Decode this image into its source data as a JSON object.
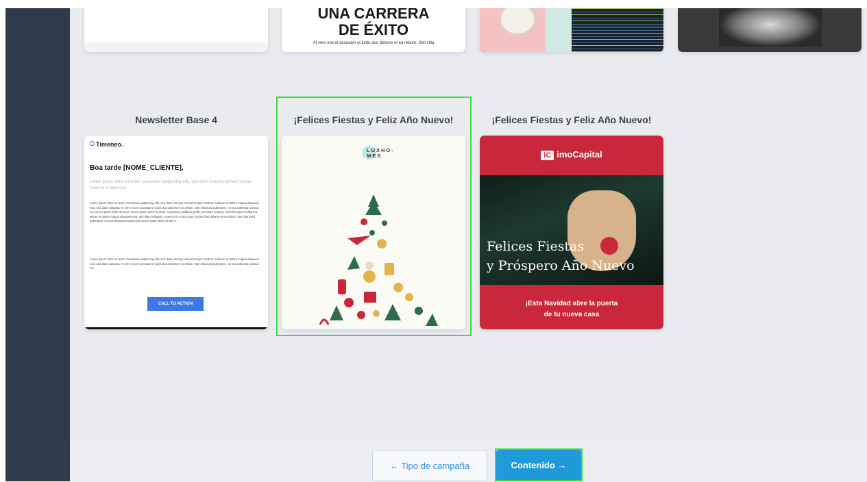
{
  "top_cards": {
    "card2_title_line1": "UNA CARRERA",
    "card2_title_line2": "DE ÉXITO",
    "card2_text": "At vero eos et accusam et justo duo dolores et ea rebum. Stet clita"
  },
  "templates": [
    {
      "title": "Newsletter Base 4",
      "brand": "Timeneo.",
      "greeting": "Boa tarde [NOME_CLIENTE],",
      "lead": "Lorem ipsum dolor sit amet, consetetur sadipscing elitr, sed diam nonumy eirmod tempor invidunt ut labore et.",
      "body1": "Lorem ipsum dolor sit amet, consetetur sadipscing elitr, sed diam nonumy eirmod tempor invidunt ut labore et dolore magna aliquyam erat, sed diam voluptua. At vero eos et accusam et justo duo dolores et ea rebum. Stet clita kasd gubergren, no sea takimata sanctus est Lorem ipsum dolor sit amet. Lorem ipsum dolor sit amet, consetetur sadipscing elitr, sed diam nonumy eirmod tempor invidunt ut labore et dolore magna aliquyam erat, sed diam voluptua. At vero eos et accusam et justo duo dolores et ea rebum. Stet clita kasd gubergren, no sea takimata sanctus est Lorem ipsum dolor sit amet.",
      "body2": "Lorem ipsum dolor sit amet, consetetur sadipscing elitr, sed diam nonumy eirmod tempor invidunt ut labore et dolore magna aliquyam erat, sed diam voluptua. At vero eos et accusam et justo duo dolores et ea rebum. Stet clita kasd gubergren, no sea takimata sanctus est.",
      "cta": "CALL TO ACTION"
    },
    {
      "title": "¡Felices Fiestas y Feliz Año Nuevo!",
      "logo_text": "LUXHO-MES"
    },
    {
      "title": "¡Felices Fiestas y Feliz Año Nuevo!",
      "brand_badge": "iC",
      "brand": "imoCapital",
      "headline_line1": "Felices Fiestas",
      "headline_line2": "y Próspero Año Nuevo",
      "sub_line1": "¡Esta Navidad abre la puerta",
      "sub_line2": "de tu nueva casa"
    }
  ],
  "footer": {
    "back_label": "← Tipo de campaña",
    "next_label": "Contenido →"
  },
  "colors": {
    "selection": "#36e236",
    "primary_button": "#1f9ad8",
    "sidebar": "#2f3a4a",
    "red_card": "#c9283a"
  }
}
